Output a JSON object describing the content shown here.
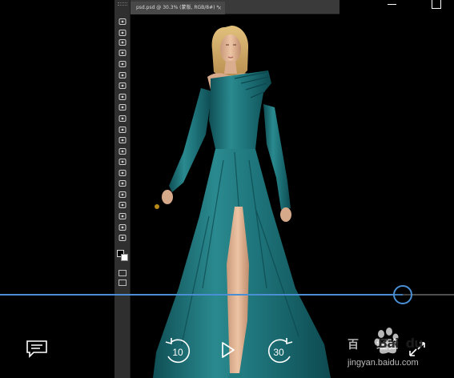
{
  "video": {
    "document_tab": "psd.psd @ 30.3% (蒙版, RGB/8#) *",
    "tab_close_glyph": "×"
  },
  "playback": {
    "progress_fraction": 0.888,
    "skip_back_seconds": "10",
    "skip_forward_seconds": "30"
  },
  "watermark": {
    "brand": "Bai  du",
    "brand_cn": "百      经验",
    "url": "jingyan.baidu.com"
  },
  "icons": {
    "captions": "closed-captions-icon",
    "rewind": "skip-back-10-icon",
    "play": "play-icon",
    "forward": "skip-forward-30-icon",
    "minimize": "minimize-icon",
    "maximize": "maximize-icon"
  },
  "colors": {
    "accent": "#4a8fd4",
    "gown": "#1f7b80",
    "ps_panel": "#2f2f2f"
  }
}
